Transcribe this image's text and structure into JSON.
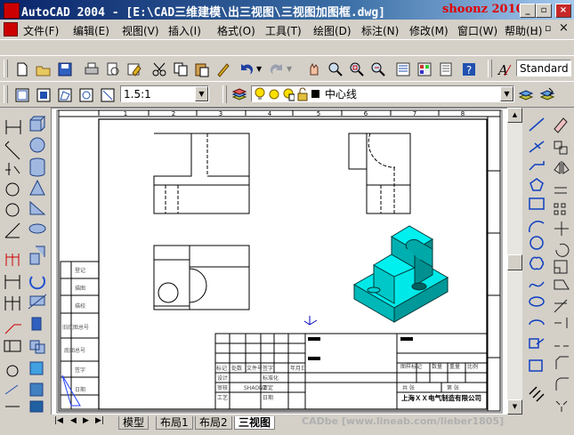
{
  "window": {
    "title": "AutoCAD 2004 - [E:\\CAD三维建模\\出三视图\\三视图加图框.dwg]",
    "watermark": "shoonz 2010"
  },
  "menu": {
    "items": [
      "文件(F)",
      "编辑(E)",
      "视图(V)",
      "插入(I)",
      "格式(O)",
      "工具(T)",
      "绘图(D)",
      "标注(N)",
      "修改(M)",
      "窗口(W)",
      "帮助(H)"
    ]
  },
  "toolbar": {
    "text_style": "Standard",
    "scale": "1.5:1",
    "layer": "中心线"
  },
  "drawing": {
    "column_numbers": [
      "1",
      "2",
      "3",
      "4",
      "5",
      "6",
      "7",
      "8"
    ],
    "left_table_labels": [
      "登记",
      "描图",
      "描校",
      "旧底图总号",
      "底图总号",
      "签字",
      "日期"
    ],
    "title_block": {
      "rev_headers": [
        "标记",
        "处数",
        "文件号",
        "签字",
        "年月日"
      ],
      "roles": [
        "设计",
        "审核",
        "工艺"
      ],
      "role_values": [
        "SHAONZ",
        "",
        ""
      ],
      "roles2": [
        "标准化",
        "审定",
        "日期"
      ],
      "scale_headers": [
        "图样标记",
        "数量",
        "重量",
        "比例"
      ],
      "sheet": "共 张",
      "sheet2": "第 张",
      "company": "上海ＸＸ电气制造有限公司"
    }
  },
  "tabs": {
    "items": [
      "模型",
      "布局1",
      "布局2",
      "三视图"
    ],
    "active_index": 3
  },
  "footer_watermark": "CADbe [www.lineab.com/lieber1805]",
  "colors": {
    "title_bar": "#0a246a",
    "iso_model": "#00d8d8",
    "watermark": "#e00000"
  }
}
